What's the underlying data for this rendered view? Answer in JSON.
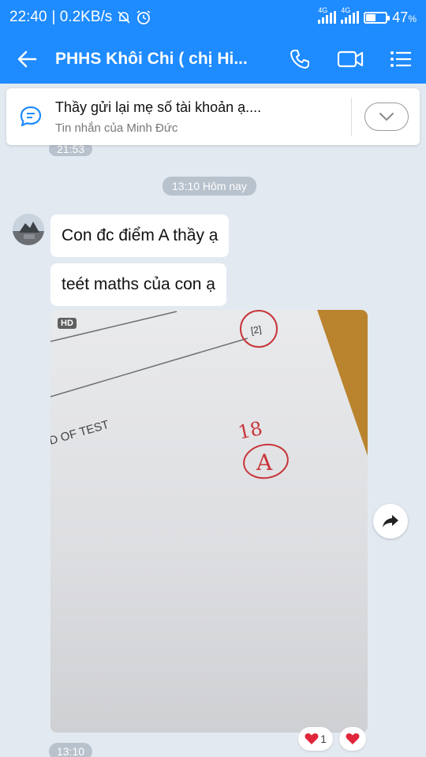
{
  "status_bar": {
    "time": "22:40",
    "network_speed": "| 0.2KB/s",
    "network_label_1": "4G",
    "network_label_2": "4G",
    "battery_level": 0.47,
    "battery_text": "47",
    "battery_unit": "%"
  },
  "app_bar": {
    "title": "PHHS Khôi Chi ( chị Hi...",
    "icons": [
      "back-arrow-icon",
      "phone-icon",
      "video-call-icon",
      "menu-icon"
    ]
  },
  "pinned": {
    "message": "Thầy gửi lại mẹ số tài khoản ạ....",
    "subtitle": "Tin nhắn của Minh Đức"
  },
  "chat": {
    "prev_time": "21:53",
    "date_label": "13:10 Hôm nay",
    "messages": [
      {
        "text": "Con đc điểm A thầy ạ"
      },
      {
        "text": "teét maths của con ạ"
      }
    ],
    "photo": {
      "hd_badge": "HD",
      "paper_text": "D OF TEST",
      "mark_score": "18",
      "mark_grade": "A",
      "circle_text": "[2]"
    },
    "reaction_count": "1",
    "last_time": "13:10"
  },
  "colors": {
    "primary": "#1e8bff",
    "chat_bg": "#e2e9f1",
    "heart": "#e0263a",
    "pen_red": "#c8353a"
  }
}
